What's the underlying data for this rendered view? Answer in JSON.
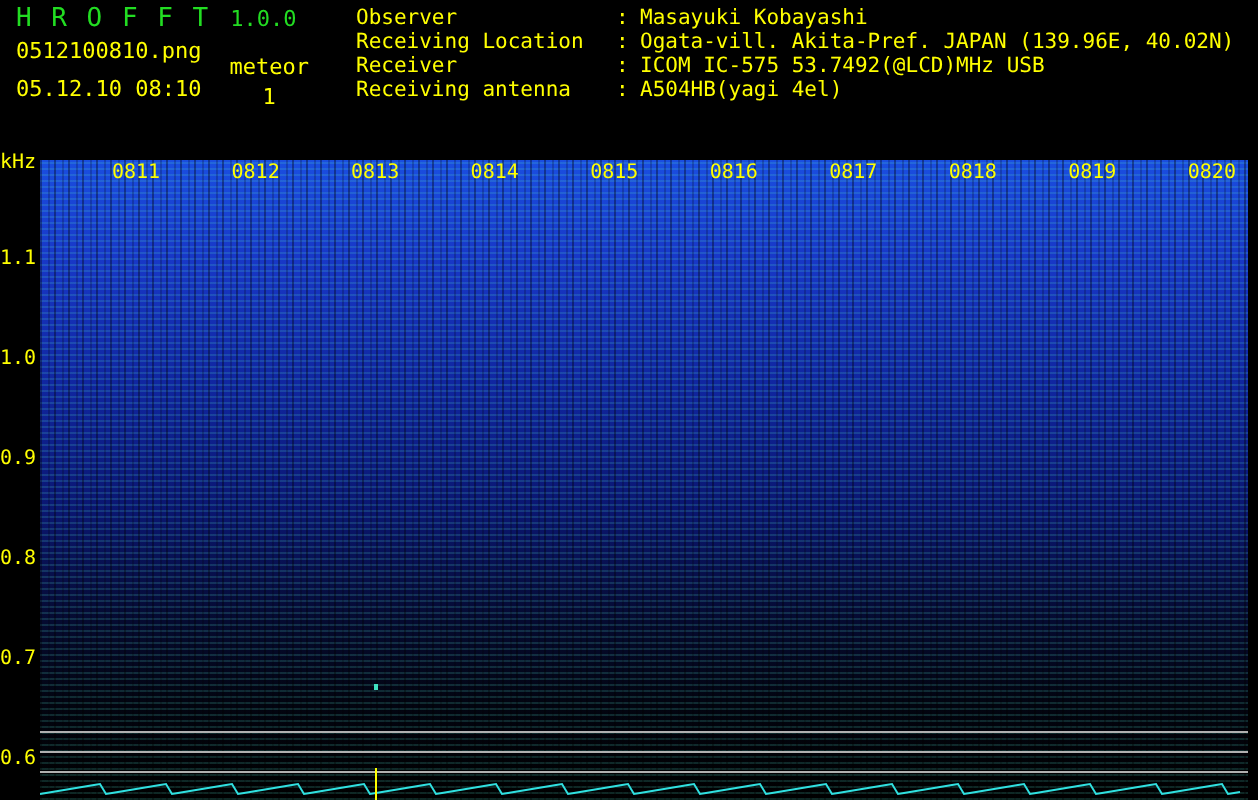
{
  "header": {
    "app_title": "H R O F F T",
    "version": "1.0.0",
    "filename": "0512100810.png",
    "datetime": "05.12.10 08:10",
    "meteor_label": "meteor",
    "meteor_count": "1",
    "info": [
      {
        "label": "Observer",
        "separator": ":",
        "value": "Masayuki Kobayashi"
      },
      {
        "label": "Receiving Location",
        "separator": ":",
        "value": "Ogata-vill. Akita-Pref. JAPAN (139.96E, 40.02N)"
      },
      {
        "label": "Receiver",
        "separator": ":",
        "value": "ICOM IC-575 53.7492(@LCD)MHz USB"
      },
      {
        "label": "Receiving antenna",
        "separator": ":",
        "value": "A504HB(yagi 4el)"
      }
    ]
  },
  "spectrogram": {
    "y_unit": "kHz",
    "y_labels": [
      "1.1",
      "1.0",
      "0.9",
      "0.8",
      "0.7",
      "0.6"
    ],
    "time_labels": [
      "0811",
      "0812",
      "0813",
      "0814",
      "0815",
      "0816",
      "0817",
      "0818",
      "0819",
      "0820"
    ]
  }
}
